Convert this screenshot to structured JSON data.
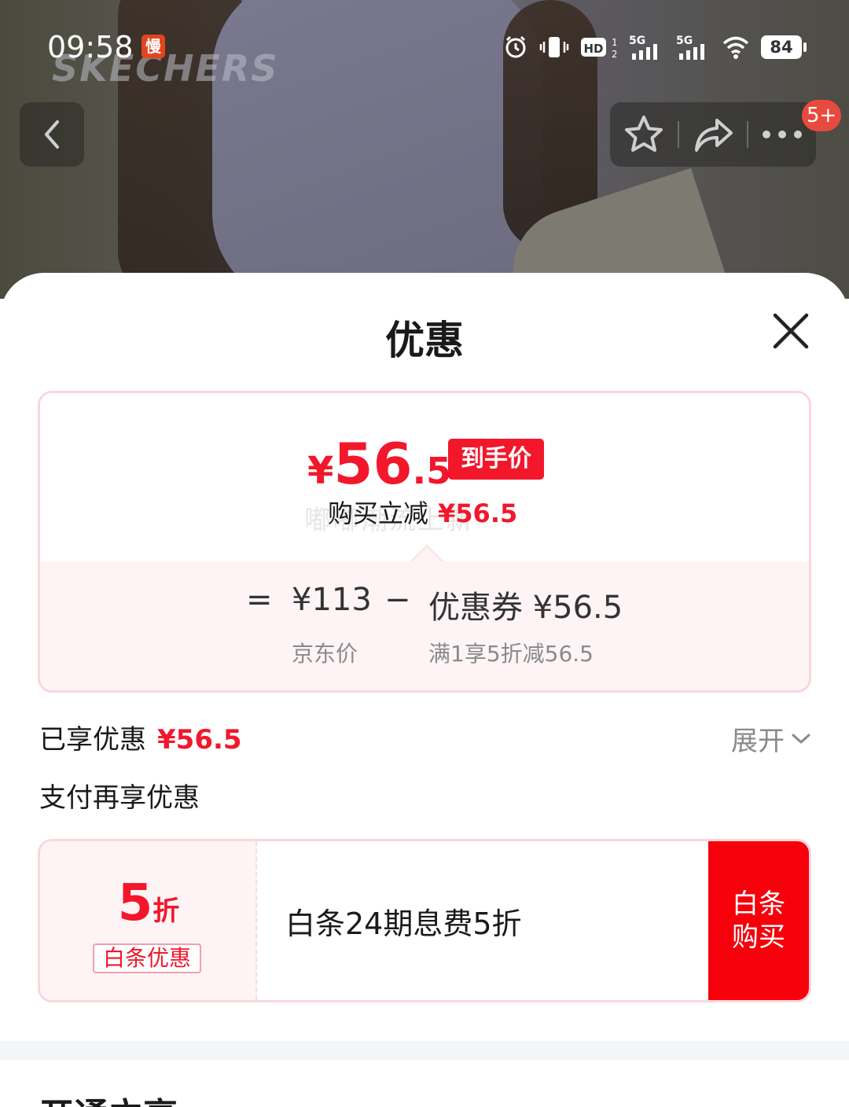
{
  "status_bar": {
    "time": "09:58",
    "slow_badge": "慢",
    "battery": "84",
    "network_1": "5G",
    "network_2": "5G",
    "hd": "HD"
  },
  "background": {
    "brand": "SKECHERS"
  },
  "nav": {
    "message_badge": "5+"
  },
  "sheet": {
    "title": "优惠",
    "final_price": {
      "yen": "¥",
      "integer": "56",
      "decimal": ".5",
      "tag": "到手价"
    },
    "reduce_label": "购买立减",
    "reduce_amount": "¥56.5",
    "watermark": "嘟嘟潮流上新",
    "calc": {
      "equals": "=",
      "jd_price": "¥113",
      "minus": "−",
      "coupon": "优惠券 ¥56.5"
    },
    "calc_sub": {
      "jd_price_label": "京东价",
      "coupon_rule": "满1享5折减56.5"
    },
    "enjoyed_label": "已享优惠",
    "enjoyed_amount": "¥56.5",
    "expand_label": "展开",
    "pay_more_label": "支付再享优惠",
    "coupon_card": {
      "discount_num": "5",
      "discount_unit": "折",
      "tag": "白条优惠",
      "description": "白条24期息费5折",
      "button_line1": "白条",
      "button_line2": "购买"
    },
    "next_section_title": "开通立享"
  },
  "colors": {
    "accent_red": "#f2172b",
    "button_red": "#f5000b",
    "card_border": "#fbd6dc"
  }
}
